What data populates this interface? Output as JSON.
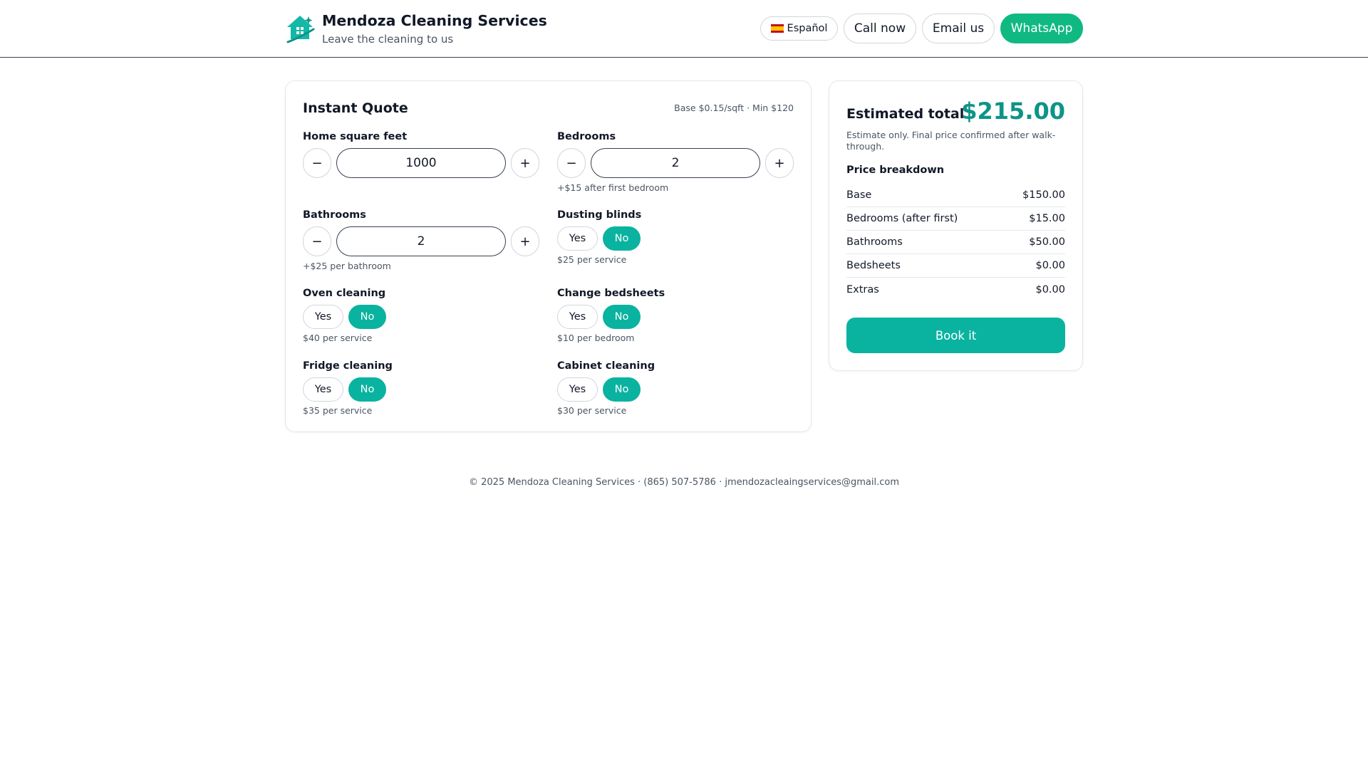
{
  "header": {
    "title": "Mendoza Cleaning Services",
    "tagline": "Leave the cleaning to us",
    "logo_icon": "house-sparkle-icon",
    "buttons": {
      "language": "Español",
      "call": "Call now",
      "email": "Email us",
      "whatsapp": "WhatsApp"
    }
  },
  "quote": {
    "title": "Instant Quote",
    "note": "Base $0.15/sqft · Min $120",
    "sqft": {
      "label": "Home square feet",
      "value": "1000",
      "minus": "−",
      "plus": "+"
    },
    "bedrooms": {
      "label": "Bedrooms",
      "value": "2",
      "minus": "−",
      "plus": "+",
      "hint": "+$15 after first bedroom"
    },
    "bathrooms": {
      "label": "Bathrooms",
      "value": "2",
      "minus": "−",
      "plus": "+",
      "hint": "+$25 per bathroom"
    },
    "dusting_blinds": {
      "label": "Dusting blinds",
      "yes": "Yes",
      "no": "No",
      "selected": "No",
      "hint": "$25 per service"
    },
    "oven_cleaning": {
      "label": "Oven cleaning",
      "yes": "Yes",
      "no": "No",
      "selected": "No",
      "hint": "$40 per service"
    },
    "change_bedsheets": {
      "label": "Change bedsheets",
      "yes": "Yes",
      "no": "No",
      "selected": "No",
      "hint": "$10 per bedroom"
    },
    "fridge_cleaning": {
      "label": "Fridge cleaning",
      "yes": "Yes",
      "no": "No",
      "selected": "No",
      "hint": "$35 per service"
    },
    "cabinet_cleaning": {
      "label": "Cabinet cleaning",
      "yes": "Yes",
      "no": "No",
      "selected": "No",
      "hint": "$30 per service"
    }
  },
  "total": {
    "label": "Estimated total",
    "amount": "$215.00",
    "note": "Estimate only. Final price confirmed after walk-through.",
    "breakdown_title": "Price breakdown",
    "breakdown": [
      {
        "label": "Base",
        "value": "$150.00"
      },
      {
        "label": "Bedrooms (after first)",
        "value": "$15.00"
      },
      {
        "label": "Bathrooms",
        "value": "$50.00"
      },
      {
        "label": "Bedsheets",
        "value": "$0.00"
      },
      {
        "label": "Extras",
        "value": "$0.00"
      }
    ],
    "book_button": "Book it"
  },
  "footer": {
    "text": "© 2025 Mendoza Cleaning Services · (865) 507-5786 · jmendozacleaingservices@gmail.com"
  },
  "colors": {
    "accent": "#0ab3a0",
    "whatsapp": "#10b981",
    "total_amount": "#0d9488"
  }
}
